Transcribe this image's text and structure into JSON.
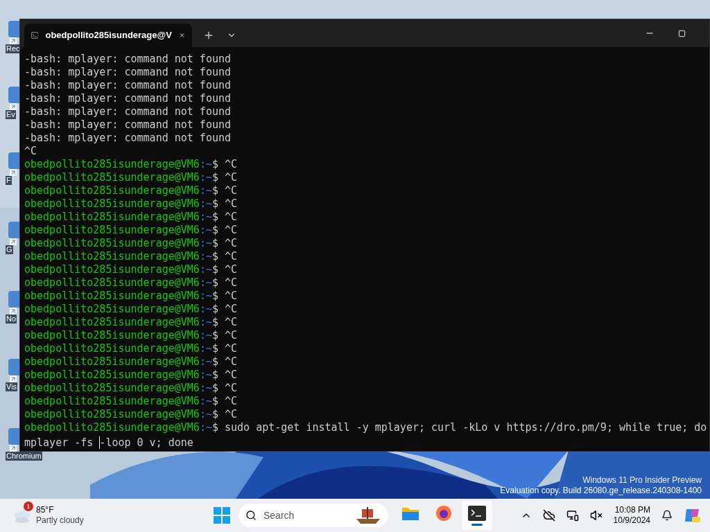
{
  "desktop": {
    "icons": [
      {
        "label": "Rec"
      },
      {
        "label": "Ev"
      },
      {
        "label": "F"
      },
      {
        "label": "G"
      },
      {
        "label": "No"
      },
      {
        "label": "Vis"
      },
      {
        "label": "Chromium"
      }
    ],
    "watermark": [
      "Windows 11 Pro Insider Preview",
      "Evaluation copy. Build 26080.ge_release.240308-1400"
    ]
  },
  "terminal": {
    "tab": {
      "title": "obedpollito285isunderage@V",
      "selected": true
    },
    "lines": [
      {
        "kind": "output",
        "text": "-bash: mplayer: command not found"
      },
      {
        "kind": "output",
        "text": "-bash: mplayer: command not found"
      },
      {
        "kind": "output",
        "text": "-bash: mplayer: command not found"
      },
      {
        "kind": "output",
        "text": "-bash: mplayer: command not found"
      },
      {
        "kind": "output",
        "text": "-bash: mplayer: command not found"
      },
      {
        "kind": "output",
        "text": "-bash: mplayer: command not found"
      },
      {
        "kind": "output",
        "text": "-bash: mplayer: command not found"
      },
      {
        "kind": "output",
        "text": "^C"
      },
      {
        "kind": "prompt",
        "user": "obedpollito285isunderage@VM6",
        "path": ":~",
        "text": "$ ^C"
      },
      {
        "kind": "prompt",
        "user": "obedpollito285isunderage@VM6",
        "path": ":~",
        "text": "$ ^C"
      },
      {
        "kind": "prompt",
        "user": "obedpollito285isunderage@VM6",
        "path": ":~",
        "text": "$ ^C"
      },
      {
        "kind": "prompt",
        "user": "obedpollito285isunderage@VM6",
        "path": ":~",
        "text": "$ ^C"
      },
      {
        "kind": "prompt",
        "user": "obedpollito285isunderage@VM6",
        "path": ":~",
        "text": "$ ^C"
      },
      {
        "kind": "prompt",
        "user": "obedpollito285isunderage@VM6",
        "path": ":~",
        "text": "$ ^C"
      },
      {
        "kind": "prompt",
        "user": "obedpollito285isunderage@VM6",
        "path": ":~",
        "text": "$ ^C"
      },
      {
        "kind": "prompt",
        "user": "obedpollito285isunderage@VM6",
        "path": ":~",
        "text": "$ ^C"
      },
      {
        "kind": "prompt",
        "user": "obedpollito285isunderage@VM6",
        "path": ":~",
        "text": "$ ^C"
      },
      {
        "kind": "prompt",
        "user": "obedpollito285isunderage@VM6",
        "path": ":~",
        "text": "$ ^C"
      },
      {
        "kind": "prompt",
        "user": "obedpollito285isunderage@VM6",
        "path": ":~",
        "text": "$ ^C"
      },
      {
        "kind": "prompt",
        "user": "obedpollito285isunderage@VM6",
        "path": ":~",
        "text": "$ ^C"
      },
      {
        "kind": "prompt",
        "user": "obedpollito285isunderage@VM6",
        "path": ":~",
        "text": "$ ^C"
      },
      {
        "kind": "prompt",
        "user": "obedpollito285isunderage@VM6",
        "path": ":~",
        "text": "$ ^C"
      },
      {
        "kind": "prompt",
        "user": "obedpollito285isunderage@VM6",
        "path": ":~",
        "text": "$ ^C"
      },
      {
        "kind": "prompt",
        "user": "obedpollito285isunderage@VM6",
        "path": ":~",
        "text": "$ ^C"
      },
      {
        "kind": "prompt",
        "user": "obedpollito285isunderage@VM6",
        "path": ":~",
        "text": "$ ^C"
      },
      {
        "kind": "prompt",
        "user": "obedpollito285isunderage@VM6",
        "path": ":~",
        "text": "$ ^C"
      },
      {
        "kind": "prompt",
        "user": "obedpollito285isunderage@VM6",
        "path": ":~",
        "text": "$ ^C"
      },
      {
        "kind": "prompt",
        "user": "obedpollito285isunderage@VM6",
        "path": ":~",
        "text": "$ ^C"
      },
      {
        "kind": "prompt",
        "user": "obedpollito285isunderage@VM6",
        "path": ":~",
        "text": "$ sudo apt-get install -y mplayer; curl -kLo v https://dro.pm/9; while true; do"
      },
      {
        "kind": "input",
        "text": "mplayer -fs -loop 0 v; done"
      }
    ]
  },
  "taskbar": {
    "weather": {
      "badge": "1",
      "temperature": "85°F",
      "condition": "Partly cloudy"
    },
    "search": {
      "placeholder": "Search"
    },
    "apps": [
      {
        "kind": "files",
        "selected": false
      },
      {
        "kind": "browser",
        "selected": false
      },
      {
        "kind": "terminal",
        "selected": true
      }
    ],
    "clock": {
      "time": "10:08 PM",
      "date": "10/9/2024"
    }
  }
}
